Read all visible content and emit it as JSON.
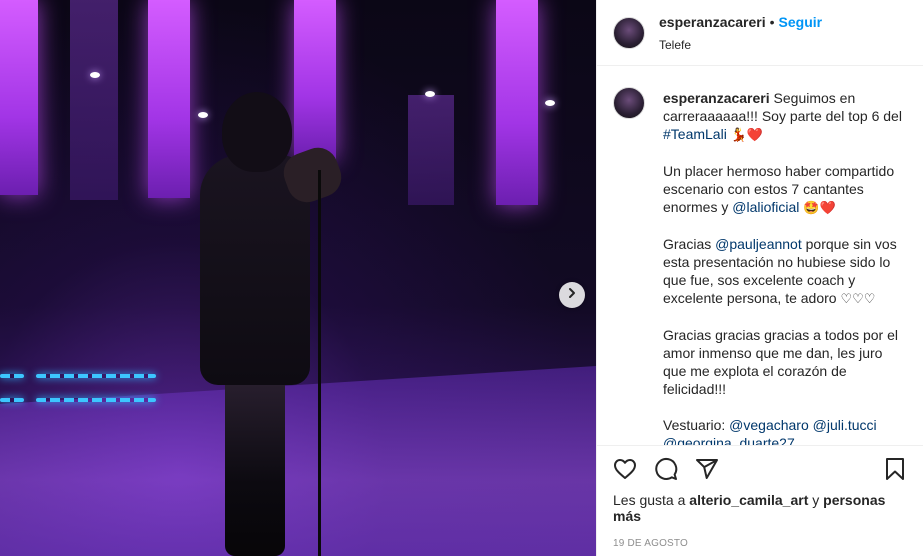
{
  "post": {
    "username": "esperanzacareri",
    "separator": "•",
    "follow_label": "Seguir",
    "location": "Telefe"
  },
  "caption": {
    "username": "esperanzacareri",
    "p1_text": "Seguimos en carreraaaaaa!!! Soy parte del top 6 del",
    "p1_tag": "#TeamLali",
    "p1_emoji": "💃❤️",
    "p2_text": "Un placer hermoso haber compartido escenario con estos 7 cantantes enormes y",
    "p2_mention": "@lalioficial",
    "p2_emoji": "🤩❤️",
    "p3_text_a": "Gracias",
    "p3_mention": "@pauljeannot",
    "p3_text_b": "porque sin vos esta presentación no hubiese sido lo que fue, sos excelente coach y excelente persona, te adoro",
    "p3_emoji": "♡♡♡",
    "p4_text": "Gracias gracias gracias a todos por el amor inmenso que me dan, les juro que me explota el corazón de felicidad!!!",
    "p5_label": "Vestuario:",
    "p5_mention1": "@vegacharo",
    "p5_mention2": "@juli.tucci",
    "p5_mention3": "@georgina_duarte27"
  },
  "actions": {
    "likes_prefix": "Les gusta a",
    "likes_user": "alterio_camila_art",
    "likes_conj": "y",
    "likes_rest": "personas más",
    "date": "19 DE AGOSTO"
  },
  "icons": {
    "next": "chevron-right-icon",
    "like": "heart-icon",
    "comment": "comment-icon",
    "share": "paper-plane-icon",
    "save": "bookmark-icon"
  },
  "colors": {
    "link": "#00376b",
    "follow": "#0095f6",
    "muted": "#8e8e8e"
  }
}
